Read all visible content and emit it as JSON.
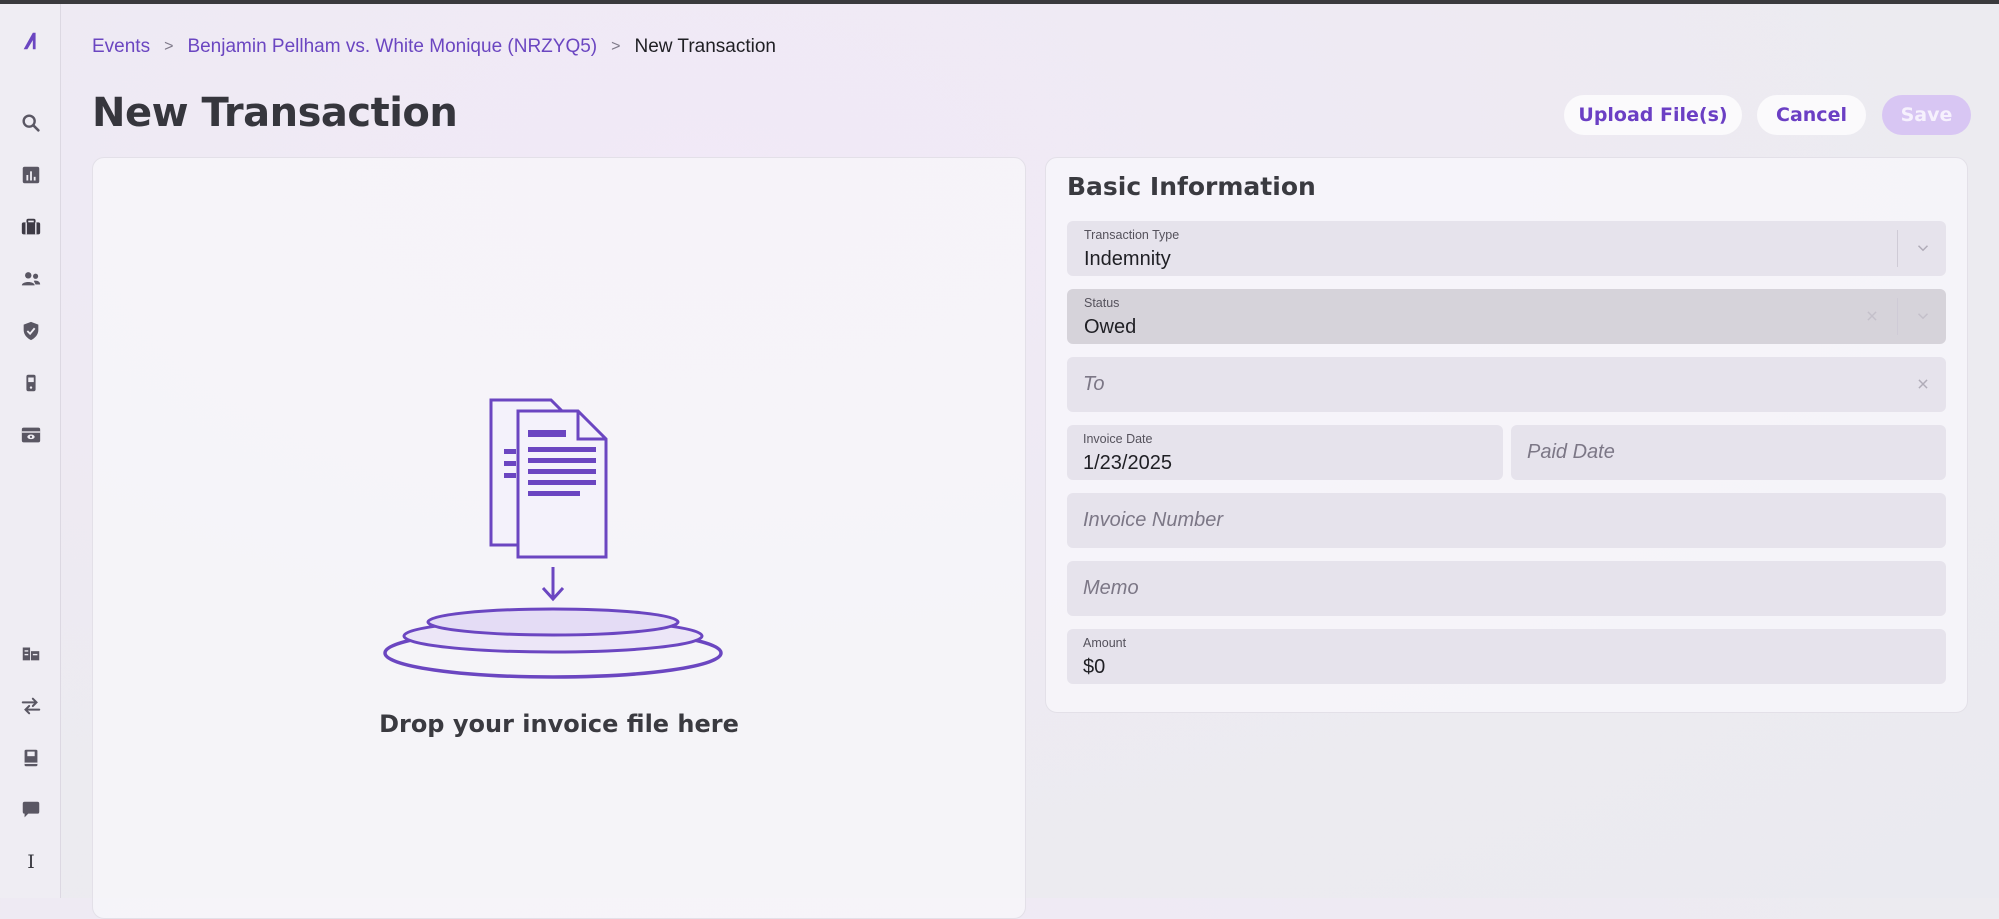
{
  "breadcrumb": {
    "events": "Events",
    "case": "Benjamin Pellham vs. White Monique (NRZYQ5)",
    "current": "New Transaction",
    "sep": ">"
  },
  "page": {
    "title": "New Transaction"
  },
  "actions": {
    "upload": "Upload File(s)",
    "cancel": "Cancel",
    "save": "Save"
  },
  "dropzone": {
    "text": "Drop your invoice file here"
  },
  "form": {
    "title": "Basic Information",
    "transaction_type": {
      "label": "Transaction Type",
      "value": "Indemnity"
    },
    "status": {
      "label": "Status",
      "value": "Owed"
    },
    "to": {
      "placeholder": "To"
    },
    "invoice_date": {
      "label": "Invoice Date",
      "value": "1/23/2025"
    },
    "paid_date": {
      "placeholder": "Paid Date"
    },
    "invoice_number": {
      "placeholder": "Invoice Number"
    },
    "memo": {
      "placeholder": "Memo"
    },
    "amount": {
      "label": "Amount",
      "value": "$0"
    }
  },
  "sidebar": {
    "bottom_letter": "I",
    "icons": [
      "logo-icon",
      "search-icon",
      "bar-chart-icon",
      "briefcase-icon",
      "users-icon",
      "shield-icon",
      "device-icon",
      "archive-icon",
      "buildings-icon",
      "transfer-icon",
      "book-icon",
      "chat-icon"
    ]
  },
  "colors": {
    "accent": "#6b46c1",
    "save_disabled": "#d8c6f3"
  }
}
